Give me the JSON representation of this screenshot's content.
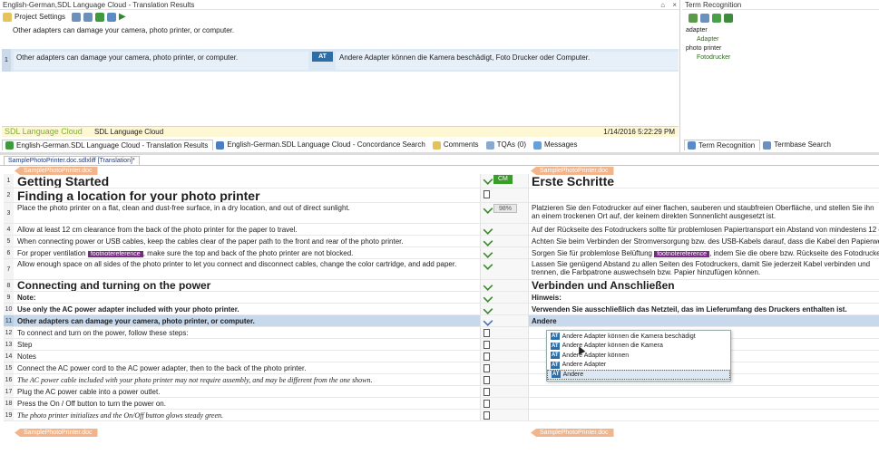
{
  "translation_results": {
    "title": "English-German,SDL Language Cloud - Translation Results",
    "window_controls": [
      "⌂",
      "×"
    ],
    "toolbar": {
      "project_settings": "Project Settings"
    },
    "source_text": "Other adapters can damage your camera, photo printer, or computer.",
    "result": {
      "number": "1",
      "source": "Other adapters can damage your camera, photo printer, or computer.",
      "badge": "AT",
      "target": "Andere Adapter können die Kamera beschädigt, Foto Drucker oder Computer."
    },
    "provider_logo": "SDL Language Cloud",
    "provider_name": "SDL Language Cloud",
    "timestamp": "1/14/2016 5:22:29 PM",
    "bottom_tabs": [
      {
        "label": "English-German.SDL Language Cloud - Translation Results",
        "icon": "translation-results-icon",
        "active": true
      },
      {
        "label": "English-German.SDL Language Cloud - Concordance Search",
        "icon": "concordance-icon"
      },
      {
        "label": "Comments",
        "icon": "comments-icon"
      },
      {
        "label": "TQAs (0)",
        "icon": "tqa-icon"
      },
      {
        "label": "Messages",
        "icon": "messages-icon"
      }
    ]
  },
  "term_recognition": {
    "title": "Term Recognition",
    "terms": [
      {
        "source": "adapter",
        "target": "Adapter"
      },
      {
        "source": "photo printer",
        "target": "Fotodrucker"
      }
    ],
    "tabs": [
      {
        "label": "Term Recognition",
        "active": true
      },
      {
        "label": "Termbase Search"
      }
    ]
  },
  "editor": {
    "doc_tab": "SamplePhotoPrinter.doc.sdlxliff [Translation]*",
    "file_tag": "SamplePhotoPrinter.doc",
    "segments": [
      {
        "n": "1",
        "style": "h1",
        "source": "Getting Started",
        "target": "Erste Schritte",
        "badge": "CM"
      },
      {
        "n": "2",
        "style": "h1",
        "source": "Finding a location for your photo printer",
        "target": ""
      },
      {
        "n": "3",
        "style": "tall",
        "source": "Place the photo printer on a flat, clean and dust-free surface, in a dry location, and out of direct sunlight.",
        "target": "Platzieren Sie den Fotodrucker auf einer flachen, sauberen und staubfreien Oberfläche, und stellen Sie ihn an einem trockenen Ort auf, der keinem direkten Sonnenlicht ausgesetzt ist.",
        "badge": "98%"
      },
      {
        "n": "4",
        "style": "",
        "source": "Allow at least 12 cm clearance from the back of the photo printer for the paper to travel.",
        "target": "Auf der Rückseite des Fotodruckers sollte für problemlosen Papiertransport ein Abstand von mindestens 12 cm vorhanden sein."
      },
      {
        "n": "5",
        "style": "",
        "source": "When connecting power or USB cables, keep the cables clear of the paper path to the front and rear of the photo printer.",
        "target": "Achten Sie beim Verbinden der Stromversorgung bzw. des USB-Kabels darauf, dass die Kabel den Papierweg nicht blockieren."
      },
      {
        "n": "6",
        "style": "",
        "source_pre": "For proper ventilation",
        "source_tag": "footnotereference",
        "source_post": ", make sure the top and back of the photo printer are not blocked.",
        "target_pre": "Sorgen Sie für problemlose Belüftung",
        "target_tag": "footnotereference",
        "target_post": ", indem Sie die obere bzw. Rückseite des Fotodruckers nicht verstellen."
      },
      {
        "n": "7",
        "style": "tall",
        "source": "Allow enough space on all sides of the photo printer to let you connect and disconnect cables, change the color cartridge, and add paper.",
        "target": "Lassen Sie genügend Abstand zu allen Seiten des Fotodruckers, damit Sie jederzeit Kabel verbinden und trennen, die Farbpatrone auswechseln bzw. Papier hinzufügen können."
      },
      {
        "n": "8",
        "style": "h2",
        "source": "Connecting and turning on the power",
        "target": "Verbinden und Anschließen"
      },
      {
        "n": "9",
        "style": "bold",
        "source": "Note:",
        "target": "Hinweis:"
      },
      {
        "n": "10",
        "style": "bold",
        "source": "Use only the AC power adapter included with your photo printer.",
        "target": "Verwenden Sie ausschließlich das Netzteil, das im Lieferumfang des Druckers enthalten ist."
      },
      {
        "n": "11",
        "style": "bold sel",
        "source": "Other adapters can damage your camera, photo printer, or computer.",
        "target": "Andere"
      },
      {
        "n": "12",
        "style": "",
        "source": "To connect and turn on the power, follow these steps:",
        "target": ""
      },
      {
        "n": "13",
        "style": "",
        "source": "Step",
        "target": ""
      },
      {
        "n": "14",
        "style": "",
        "source": "Notes",
        "target": ""
      },
      {
        "n": "15",
        "style": "",
        "source": "Connect the AC power cord to the AC power adapter, then to the back of the photo printer.",
        "target": ""
      },
      {
        "n": "16",
        "style": "italic",
        "source": "The AC power cable included with your photo printer may not require assembly, and may be different from the one shown.",
        "target": ""
      },
      {
        "n": "17",
        "style": "",
        "source": "Plug the AC power cable into a power outlet.",
        "target": ""
      },
      {
        "n": "18",
        "style": "",
        "source": "Press the On / Off button to turn the power on.",
        "target": ""
      },
      {
        "n": "19",
        "style": "italic",
        "source": "The photo printer initializes and the On/Off button glows steady green.",
        "target": ""
      }
    ],
    "autosuggest": [
      {
        "badge": "AT",
        "text": "Andere Adapter können die Kamera beschädigt"
      },
      {
        "badge": "AT",
        "text": "Andere Adapter können die Kamera"
      },
      {
        "badge": "AT",
        "text": "Andere Adapter können"
      },
      {
        "badge": "AT",
        "text": "Andere Adapter"
      },
      {
        "badge": "AT",
        "text": "Andere",
        "active": true
      }
    ]
  },
  "colors": {
    "selection": "#c8d9ec",
    "accent_blue": "#2e6ea6",
    "confirmed_green": "#3a9c2a",
    "file_tag": "#f2b48a",
    "footnote_tag": "#7a2a86",
    "sdl_green": "#7fb02d"
  }
}
